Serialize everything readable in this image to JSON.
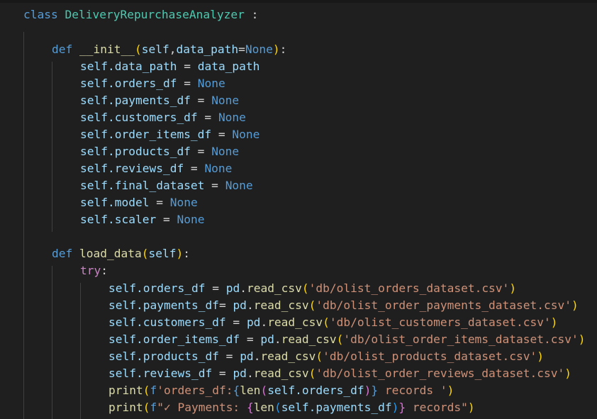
{
  "code": {
    "class_keyword": "class",
    "class_name": "DeliveryRepurchaseAnalyzer",
    "class_colon": " :",
    "def_keyword": "def",
    "init_name": "__init__",
    "self": "self",
    "data_path_param": "data_path",
    "none": "None",
    "attrs": {
      "data_path": ".data_path",
      "orders_df": ".orders_df",
      "payments_df": ".payments_df",
      "customers_df": ".customers_df",
      "order_items_df": ".order_items_df",
      "products_df": ".products_df",
      "reviews_df": ".reviews_df",
      "final_dataset": ".final_dataset",
      "model": ".model",
      "scaler": ".scaler"
    },
    "load_data_name": "load_data",
    "try_keyword": "try",
    "pd": "pd",
    "read_csv": "read_csv",
    "files": {
      "orders": "'db/olist_orders_dataset.csv'",
      "payments": "'db/olist_order_payments_dataset.csv'",
      "customers": "'db/olist_customers_dataset.csv'",
      "order_items": "'db/olist_order_items_dataset.csv'",
      "products": "'db/olist_products_dataset.csv'",
      "reviews": "'db/olist_order_reviews_dataset.csv'"
    },
    "print_fn": "print",
    "len_fn": "len",
    "fprefix": "f",
    "print1_str_start": "'orders_df:",
    "print1_str_end": " records '",
    "print2_str_start": "\"✓ Payments: ",
    "print2_str_end": " records\""
  }
}
